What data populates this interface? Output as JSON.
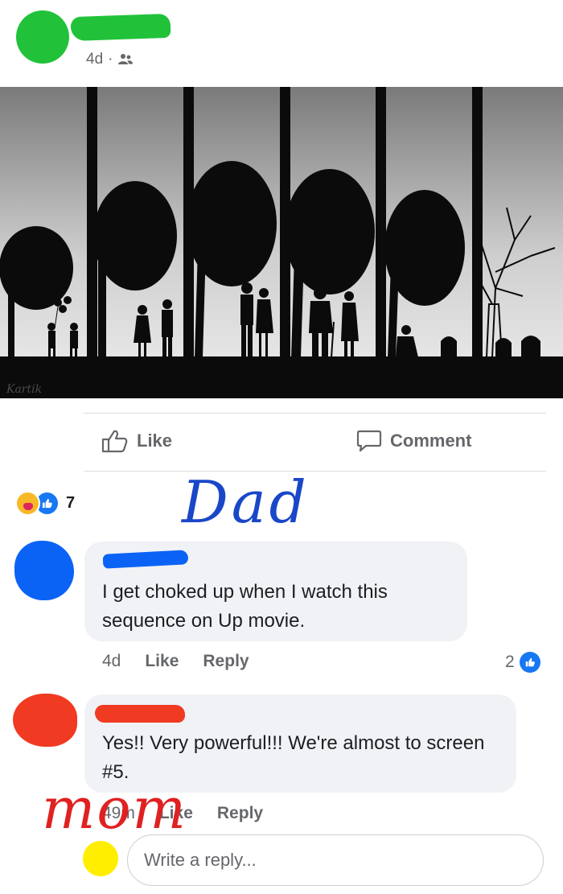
{
  "post": {
    "time": "4d",
    "separator": "·",
    "audience_icon": "friends-icon",
    "image_alt": "Five-panel silhouette sequence of a couple aging beside a tree",
    "image_signature": "Kartik"
  },
  "actions": {
    "like_label": "Like",
    "comment_label": "Comment"
  },
  "reactions": {
    "icons": [
      "care-reaction-icon",
      "like-reaction-icon"
    ],
    "count": "7"
  },
  "annotations": {
    "dad": "Dad",
    "mom": "mom"
  },
  "comments": [
    {
      "text": "I get choked up when I watch this sequence on Up movie.",
      "time": "4d",
      "like_label": "Like",
      "reply_label": "Reply",
      "like_count": "2"
    },
    {
      "text": "Yes!! Very powerful!!!  We're almost to screen #5.",
      "time": "49m",
      "like_label": "Like",
      "reply_label": "Reply"
    }
  ],
  "reply_box": {
    "placeholder": "Write a reply..."
  },
  "colors": {
    "accent": "#1877f2",
    "secondary_text": "#65676b",
    "bubble_bg": "#f0f2f5",
    "redact_green": "#21c23a",
    "redact_blue": "#0b63f6",
    "redact_red": "#f03a22",
    "redact_yellow": "#ffee00"
  }
}
